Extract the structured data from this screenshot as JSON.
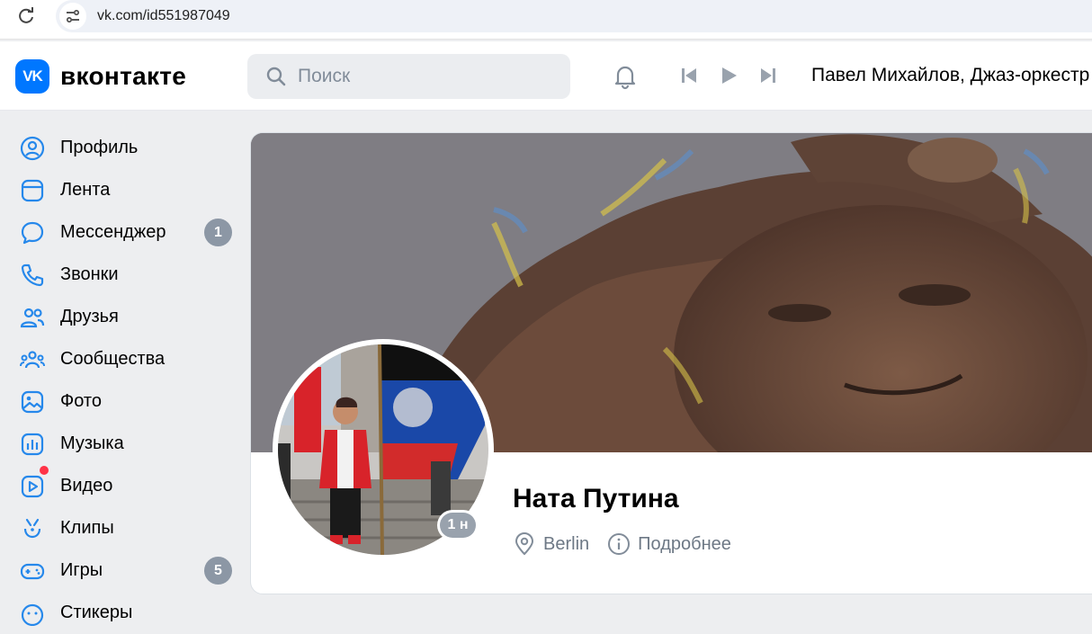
{
  "browser": {
    "url": "vk.com/id551987049"
  },
  "header": {
    "logo_mark": "VK",
    "logo_text": "вконтакте",
    "search_placeholder": "Поиск",
    "now_playing": "Павел Михайлов, Джаз-оркестр"
  },
  "sidebar": {
    "items": [
      {
        "label": "Профиль",
        "icon": "user-circle-icon"
      },
      {
        "label": "Лента",
        "icon": "newsfeed-icon"
      },
      {
        "label": "Мессенджер",
        "icon": "message-icon",
        "badge": "1"
      },
      {
        "label": "Звонки",
        "icon": "phone-icon"
      },
      {
        "label": "Друзья",
        "icon": "friends-icon"
      },
      {
        "label": "Сообщества",
        "icon": "communities-icon"
      },
      {
        "label": "Фото",
        "icon": "photo-icon"
      },
      {
        "label": "Музыка",
        "icon": "music-icon"
      },
      {
        "label": "Видео",
        "icon": "video-icon"
      },
      {
        "label": "Клипы",
        "icon": "clips-icon"
      },
      {
        "label": "Игры",
        "icon": "games-icon",
        "badge": "5"
      },
      {
        "label": "Стикеры",
        "icon": "stickers-icon"
      }
    ]
  },
  "profile": {
    "name": "Ната Путина",
    "location": "Berlin",
    "details_label": "Подробнее",
    "online_status": "1 н"
  },
  "colors": {
    "accent": "#0077ff",
    "badge": "#8c97a5",
    "muted_text": "#6d7885",
    "notification_dot": "#ff3347"
  }
}
